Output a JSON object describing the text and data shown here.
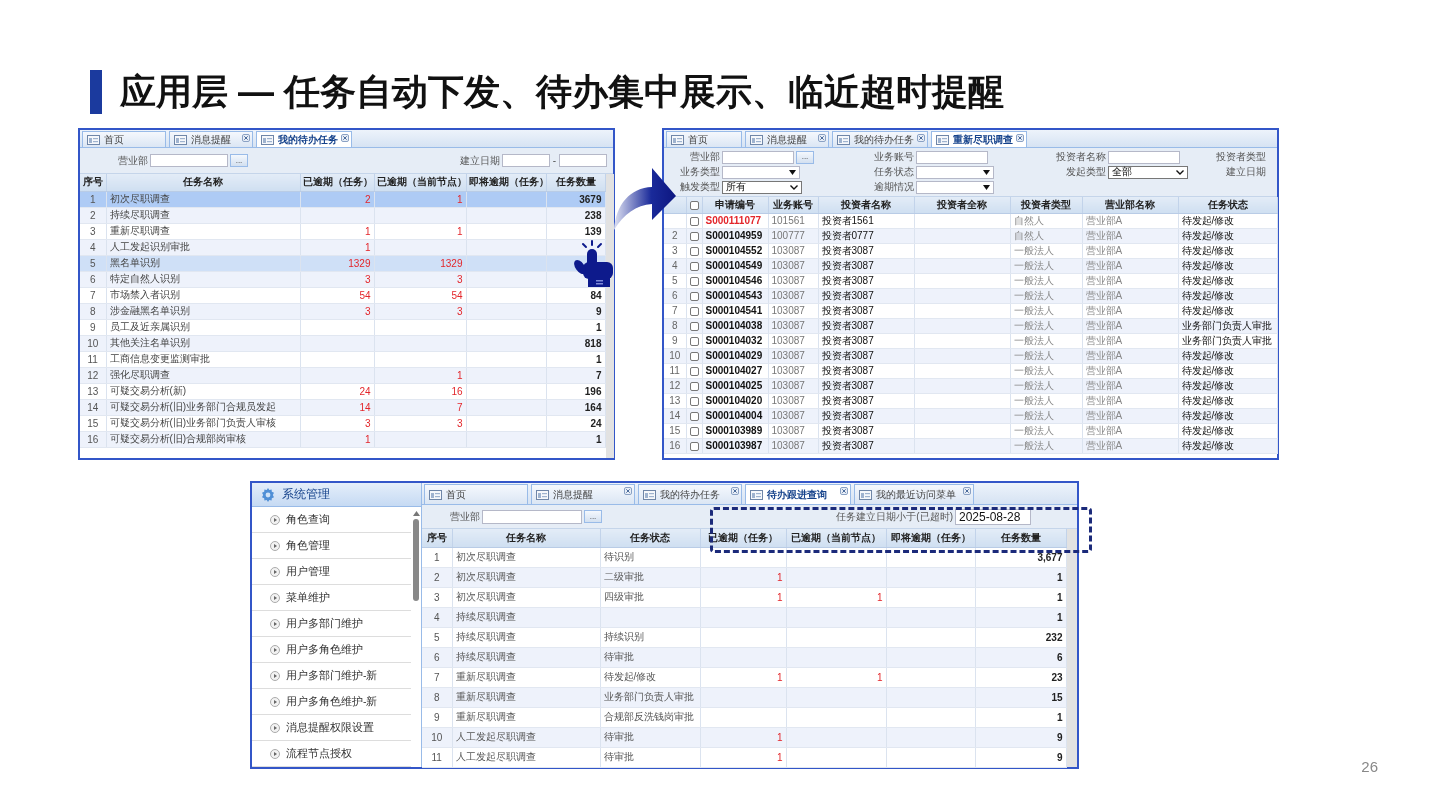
{
  "slide": {
    "title": "应用层 — 任务自动下发、待办集中展示、临近超时提醒",
    "page_number": "26"
  },
  "panel_a": {
    "tabs": [
      {
        "label": "首页",
        "selected": false,
        "closable": false
      },
      {
        "label": "消息提醒",
        "selected": false,
        "closable": true
      },
      {
        "label": "我的待办任务",
        "selected": true,
        "closable": true
      }
    ],
    "filters": {
      "branch_label": "营业部",
      "browse": "...",
      "date_label": "建立日期",
      "date_separator": "-"
    },
    "columns": [
      "序号",
      "任务名称",
      "已逾期（任务）",
      "已逾期（当前节点）",
      "即将逾期（任务）",
      "任务数量"
    ],
    "rows": [
      {
        "seq": "1",
        "name": "初次尽职调查",
        "overdue_task": "2",
        "overdue_node": "1",
        "count": "3679",
        "selected": true,
        "highlighted": false
      },
      {
        "seq": "2",
        "name": "持续尽职调查",
        "count": "238",
        "selected": false,
        "highlighted": false
      },
      {
        "seq": "3",
        "name": "重新尽职调查",
        "overdue_task": "1",
        "overdue_node": "1",
        "count": "139",
        "selected": false,
        "highlighted": false
      },
      {
        "seq": "4",
        "name": "人工发起识别审批",
        "overdue_task": "1",
        "selected": false,
        "highlighted": false
      },
      {
        "seq": "5",
        "name": "黑名单识别",
        "overdue_task": "1329",
        "overdue_node": "1329",
        "selected": false,
        "highlighted": true
      },
      {
        "seq": "6",
        "name": "特定自然人识别",
        "overdue_task": "3",
        "overdue_node": "3",
        "selected": false,
        "highlighted": false
      },
      {
        "seq": "7",
        "name": "市场禁入者识别",
        "overdue_task": "54",
        "overdue_node": "54",
        "count": "84",
        "selected": false,
        "highlighted": false
      },
      {
        "seq": "8",
        "name": "涉金融黑名单识别",
        "overdue_task": "3",
        "overdue_node": "3",
        "count": "9",
        "selected": false,
        "highlighted": false
      },
      {
        "seq": "9",
        "name": "员工及近亲属识别",
        "count": "1",
        "selected": false,
        "highlighted": false
      },
      {
        "seq": "10",
        "name": "其他关注名单识别",
        "count": "818",
        "selected": false,
        "highlighted": false
      },
      {
        "seq": "11",
        "name": "工商信息变更监测审批",
        "count": "1",
        "selected": false,
        "highlighted": false
      },
      {
        "seq": "12",
        "name": "强化尽职调查",
        "overdue_node": "1",
        "count": "7",
        "selected": false,
        "highlighted": false
      },
      {
        "seq": "13",
        "name": "可疑交易分析(新)",
        "overdue_task": "24",
        "overdue_node": "16",
        "count": "196",
        "selected": false,
        "highlighted": false
      },
      {
        "seq": "14",
        "name": "可疑交易分析(旧)业务部门合规员发起",
        "overdue_task": "14",
        "overdue_node": "7",
        "count": "164",
        "selected": false,
        "highlighted": false
      },
      {
        "seq": "15",
        "name": "可疑交易分析(旧)业务部门负责人审核",
        "overdue_task": "3",
        "overdue_node": "3",
        "count": "24",
        "selected": false,
        "highlighted": false
      },
      {
        "seq": "16",
        "name": "可疑交易分析(旧)合规部岗审核",
        "overdue_task": "1",
        "count": "1",
        "selected": false,
        "highlighted": false
      }
    ]
  },
  "panel_b": {
    "tabs": [
      {
        "label": "首页",
        "selected": false,
        "closable": false
      },
      {
        "label": "消息提醒",
        "selected": false,
        "closable": true
      },
      {
        "label": "我的待办任务",
        "selected": false,
        "closable": true
      },
      {
        "label": "重新尽职调查",
        "selected": true,
        "closable": true
      }
    ],
    "filter_rows": [
      {
        "fields": [
          {
            "kind": "browse",
            "label": "营业部",
            "button": "..."
          },
          {
            "kind": "text",
            "label": "业务账号"
          },
          {
            "kind": "text",
            "label": "投资者名称"
          },
          {
            "kind": "label",
            "label": "投资者类型"
          }
        ]
      },
      {
        "fields": [
          {
            "kind": "select",
            "label": "业务类型"
          },
          {
            "kind": "select",
            "label": "任务状态"
          },
          {
            "kind": "select",
            "label": "发起类型",
            "value": "全部"
          },
          {
            "kind": "label",
            "label": "建立日期"
          }
        ]
      },
      {
        "fields": [
          {
            "kind": "select",
            "label": "触发类型",
            "value": "所有"
          },
          {
            "kind": "select",
            "label": "逾期情况"
          }
        ]
      }
    ],
    "select_all_checked": false,
    "columns": [
      "申请编号",
      "业务账号",
      "投资者名称",
      "投资者全称",
      "投资者类型",
      "营业部名称",
      "任务状态"
    ],
    "rows": [
      {
        "id": "S000111077",
        "overdue": true,
        "checked": false,
        "account": "101561",
        "investor": "投资者1561",
        "type": "自然人",
        "branch": "营业部A",
        "status": "待发起/修改"
      },
      {
        "seq": "2",
        "id": "S000104959",
        "overdue": false,
        "checked": false,
        "account": "100777",
        "investor": "投资者0777",
        "type": "自然人",
        "branch": "营业部A",
        "status": "待发起/修改"
      },
      {
        "seq": "3",
        "id": "S000104552",
        "overdue": false,
        "checked": false,
        "account": "103087",
        "investor": "投资者3087",
        "type": "一般法人",
        "branch": "营业部A",
        "status": "待发起/修改"
      },
      {
        "seq": "4",
        "id": "S000104549",
        "overdue": false,
        "checked": false,
        "account": "103087",
        "investor": "投资者3087",
        "type": "一般法人",
        "branch": "营业部A",
        "status": "待发起/修改"
      },
      {
        "seq": "5",
        "id": "S000104546",
        "overdue": false,
        "checked": false,
        "account": "103087",
        "investor": "投资者3087",
        "type": "一般法人",
        "branch": "营业部A",
        "status": "待发起/修改"
      },
      {
        "seq": "6",
        "id": "S000104543",
        "overdue": false,
        "checked": false,
        "account": "103087",
        "investor": "投资者3087",
        "type": "一般法人",
        "branch": "营业部A",
        "status": "待发起/修改"
      },
      {
        "seq": "7",
        "id": "S000104541",
        "overdue": false,
        "checked": false,
        "account": "103087",
        "investor": "投资者3087",
        "type": "一般法人",
        "branch": "营业部A",
        "status": "待发起/修改"
      },
      {
        "seq": "8",
        "id": "S000104038",
        "overdue": false,
        "checked": false,
        "account": "103087",
        "investor": "投资者3087",
        "type": "一般法人",
        "branch": "营业部A",
        "status": "业务部门负责人审批"
      },
      {
        "seq": "9",
        "id": "S000104032",
        "overdue": false,
        "checked": false,
        "account": "103087",
        "investor": "投资者3087",
        "type": "一般法人",
        "branch": "营业部A",
        "status": "业务部门负责人审批"
      },
      {
        "seq": "10",
        "id": "S000104029",
        "overdue": false,
        "checked": false,
        "account": "103087",
        "investor": "投资者3087",
        "type": "一般法人",
        "branch": "营业部A",
        "status": "待发起/修改"
      },
      {
        "seq": "11",
        "id": "S000104027",
        "overdue": false,
        "checked": false,
        "account": "103087",
        "investor": "投资者3087",
        "type": "一般法人",
        "branch": "营业部A",
        "status": "待发起/修改"
      },
      {
        "seq": "12",
        "id": "S000104025",
        "overdue": false,
        "checked": false,
        "account": "103087",
        "investor": "投资者3087",
        "type": "一般法人",
        "branch": "营业部A",
        "status": "待发起/修改"
      },
      {
        "seq": "13",
        "id": "S000104020",
        "overdue": false,
        "checked": false,
        "account": "103087",
        "investor": "投资者3087",
        "type": "一般法人",
        "branch": "营业部A",
        "status": "待发起/修改"
      },
      {
        "seq": "14",
        "id": "S000104004",
        "overdue": false,
        "checked": false,
        "account": "103087",
        "investor": "投资者3087",
        "type": "一般法人",
        "branch": "营业部A",
        "status": "待发起/修改"
      },
      {
        "seq": "15",
        "id": "S000103989",
        "overdue": false,
        "checked": false,
        "account": "103087",
        "investor": "投资者3087",
        "type": "一般法人",
        "branch": "营业部A",
        "status": "待发起/修改"
      },
      {
        "seq": "16",
        "id": "S000103987",
        "overdue": false,
        "checked": false,
        "account": "103087",
        "investor": "投资者3087",
        "type": "一般法人",
        "branch": "营业部A",
        "status": "待发起/修改"
      }
    ]
  },
  "panel_c": {
    "sidebar": {
      "title": "系统管理",
      "items": [
        "角色查询",
        "角色管理",
        "用户管理",
        "菜单维护",
        "用户多部门维护",
        "用户多角色维护",
        "用户多部门维护-新",
        "用户多角色维护-新",
        "消息提醒权限设置",
        "流程节点授权"
      ]
    },
    "tabs": [
      {
        "label": "首页",
        "selected": false,
        "closable": false
      },
      {
        "label": "消息提醒",
        "selected": false,
        "closable": true
      },
      {
        "label": "我的待办任务",
        "selected": false,
        "closable": true
      },
      {
        "label": "待办跟进查询",
        "selected": true,
        "closable": true
      },
      {
        "label": "我的最近访问菜单",
        "selected": false,
        "closable": true
      }
    ],
    "filters": {
      "branch_label": "营业部",
      "browse": "...",
      "date_label": "任务建立日期小于(已超时)",
      "date_value": "2025-08-28"
    },
    "columns": [
      "序号",
      "任务名称",
      "任务状态",
      "已逾期（任务）",
      "已逾期（当前节点）",
      "即将逾期（任务）",
      "任务数量"
    ],
    "rows": [
      {
        "seq": "1",
        "name": "初次尽职调查",
        "status": "待识别",
        "count": "3,677"
      },
      {
        "seq": "2",
        "name": "初次尽职调查",
        "status": "二级审批",
        "overdue_task": "1",
        "count": "1"
      },
      {
        "seq": "3",
        "name": "初次尽职调查",
        "status": "四级审批",
        "overdue_task": "1",
        "overdue_node": "1",
        "count": "1"
      },
      {
        "seq": "4",
        "name": "持续尽职调查",
        "count": "1"
      },
      {
        "seq": "5",
        "name": "持续尽职调查",
        "status": "持续识别",
        "count": "232"
      },
      {
        "seq": "6",
        "name": "持续尽职调查",
        "status": "待审批",
        "count": "6"
      },
      {
        "seq": "7",
        "name": "重新尽职调查",
        "status": "待发起/修改",
        "overdue_task": "1",
        "overdue_node": "1",
        "count": "23"
      },
      {
        "seq": "8",
        "name": "重新尽职调查",
        "status": "业务部门负责人审批",
        "count": "15"
      },
      {
        "seq": "9",
        "name": "重新尽职调查",
        "status": "合规部反洗钱岗审批",
        "count": "1"
      },
      {
        "seq": "10",
        "name": "人工发起尽职调查",
        "status": "待审批",
        "overdue_task": "1",
        "count": "9"
      },
      {
        "seq": "11",
        "name": "人工发起尽职调查",
        "status": "待审批",
        "overdue_task": "1",
        "count": "9"
      }
    ]
  }
}
